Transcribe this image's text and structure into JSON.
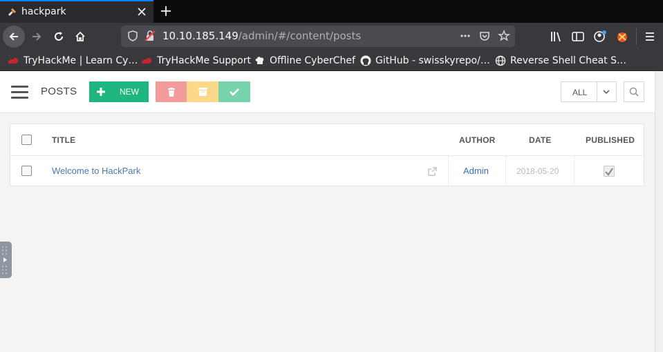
{
  "browser": {
    "tab": {
      "title": "hackpark"
    },
    "url": {
      "host": "10.10.185.149",
      "path": "/admin/#/content/posts"
    },
    "bookmarks": [
      {
        "label": "TryHackMe | Learn Cy…",
        "icon": "tryhackme-icon"
      },
      {
        "label": "TryHackMe Support",
        "icon": "tryhackme-icon"
      },
      {
        "label": "Offline CyberChef",
        "icon": "chef-hat-icon"
      },
      {
        "label": "GitHub - swisskyrepo/…",
        "icon": "github-icon"
      },
      {
        "label": "Reverse Shell Cheat S…",
        "icon": "globe-icon"
      }
    ]
  },
  "toolbar": {
    "title": "POSTS",
    "new_label": "NEW",
    "filter_label": "ALL"
  },
  "table": {
    "columns": [
      "TITLE",
      "AUTHOR",
      "DATE",
      "PUBLISHED"
    ],
    "rows": [
      {
        "title": "Welcome to HackPark",
        "author": "Admin",
        "date": "2018-05-20",
        "published": true
      }
    ]
  },
  "colors": {
    "new_button": "#1fb57e",
    "delete_button": "#f39a9a",
    "archive_button": "#fbd88a",
    "publish_button": "#76d3ab",
    "link": "#4a77b4",
    "tab_accent": "#0a84ff"
  }
}
